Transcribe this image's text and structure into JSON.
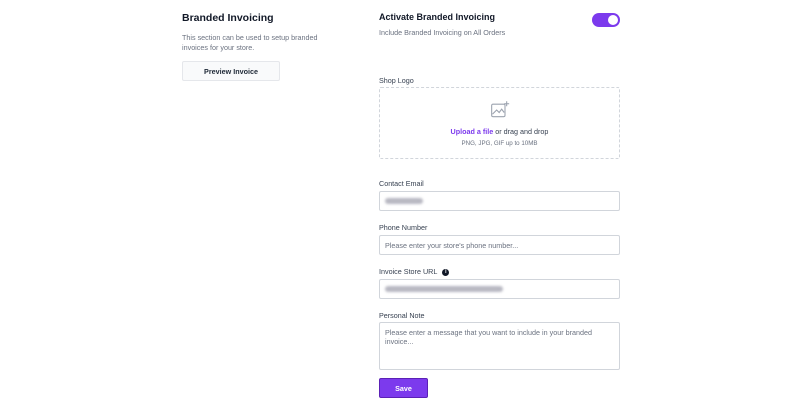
{
  "branded_invoicing": {
    "title": "Branded Invoicing",
    "description": "This section can be used to setup branded invoices for your store.",
    "preview_button": "Preview Invoice"
  },
  "activate": {
    "title": "Activate Branded Invoicing",
    "subtitle": "Include Branded Invoicing on All Orders",
    "enabled": true
  },
  "shop_logo": {
    "label": "Shop Logo",
    "upload_link": "Upload a file",
    "upload_text": " or drag and drop",
    "hint": "PNG, JPG, GIF up to 10MB",
    "icon": "image-add-icon"
  },
  "contact_email": {
    "label": "Contact Email",
    "value_redacted": true
  },
  "phone_number": {
    "label": "Phone Number",
    "placeholder": "Please enter your store's phone number..."
  },
  "invoice_store_url": {
    "label": "Invoice Store URL",
    "value_redacted": true,
    "info_icon": "info-icon"
  },
  "personal_note": {
    "label": "Personal Note",
    "placeholder": "Please enter a message that you want to include in your branded invoice..."
  },
  "save_button": "Save",
  "colors": {
    "accent": "#7c3aed",
    "text_primary": "#111827",
    "text_secondary": "#6b7280",
    "border": "#d1d5db"
  }
}
